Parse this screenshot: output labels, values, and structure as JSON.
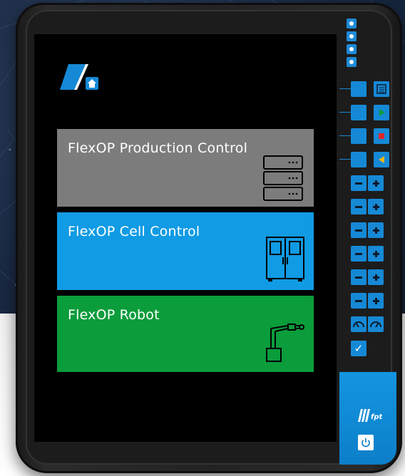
{
  "screen": {
    "tiles": [
      {
        "id": "production-control",
        "label": "FlexOP Production Control",
        "color": "#7c7c7c",
        "icon": "server-rack-icon"
      },
      {
        "id": "cell-control",
        "label": "FlexOP Cell Control",
        "color": "#109be4",
        "icon": "cabinet-icon"
      },
      {
        "id": "robot",
        "label": "FlexOP Robot",
        "color": "#0b9c3b",
        "icon": "robot-arm-icon"
      }
    ],
    "home_logo_icon": "home-icon"
  },
  "side_panel": {
    "leds": 4,
    "function_keys": [
      {
        "icon": "document-icon",
        "color": "#1689d6"
      },
      {
        "icon": "play-icon",
        "color": "#0b9c3b"
      },
      {
        "icon": "stop-icon",
        "color": "#e0262b"
      },
      {
        "icon": "back-icon",
        "color": "#f2b51b"
      }
    ],
    "jog_pairs": 6,
    "speed_icons": [
      "speed-minus-icon",
      "speed-plus-icon"
    ],
    "confirm_icon": "check-icon"
  },
  "brand": {
    "logo_text": "fpt",
    "power_icon": "power-icon"
  }
}
